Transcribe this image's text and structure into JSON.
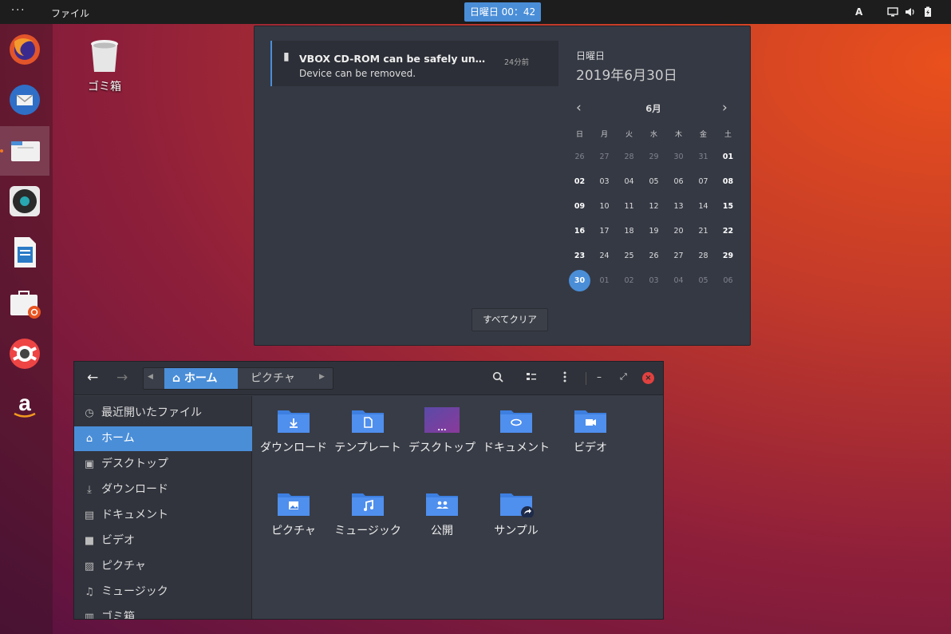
{
  "topbar": {
    "activities": "···",
    "app_menu": "ファイル",
    "clock": "日曜日 00：42",
    "keyboard": "A"
  },
  "dock": {
    "items": [
      {
        "name": "firefox"
      },
      {
        "name": "thunderbird"
      },
      {
        "name": "files"
      },
      {
        "name": "rhythmbox"
      },
      {
        "name": "libreoffice-writer"
      },
      {
        "name": "ubuntu-software"
      },
      {
        "name": "help"
      },
      {
        "name": "amazon"
      }
    ]
  },
  "desktop": {
    "trash_label": "ゴミ箱"
  },
  "notification": {
    "title": "VBOX CD-ROM can be safely unplugged",
    "time": "24分前",
    "body": "Device can be removed."
  },
  "calendar": {
    "day_name": "日曜日",
    "full_date": "2019年6月30日",
    "month": "6月",
    "weekdays": [
      "日",
      "月",
      "火",
      "水",
      "木",
      "金",
      "土"
    ],
    "weeks": [
      [
        "26",
        "27",
        "28",
        "29",
        "30",
        "31",
        "01"
      ],
      [
        "02",
        "03",
        "04",
        "05",
        "06",
        "07",
        "08"
      ],
      [
        "09",
        "10",
        "11",
        "12",
        "13",
        "14",
        "15"
      ],
      [
        "16",
        "17",
        "18",
        "19",
        "20",
        "21",
        "22"
      ],
      [
        "23",
        "24",
        "25",
        "26",
        "27",
        "28",
        "29"
      ],
      [
        "30",
        "01",
        "02",
        "03",
        "04",
        "05",
        "06"
      ]
    ],
    "today": "30",
    "clear_all": "すべてクリア"
  },
  "files": {
    "path": {
      "home": "ホーム",
      "next": "ピクチャ"
    },
    "sidebar": [
      {
        "label": "最近開いたファイル",
        "icon": "clock-icon"
      },
      {
        "label": "ホーム",
        "icon": "home-icon"
      },
      {
        "label": "デスクトップ",
        "icon": "desktop-icon"
      },
      {
        "label": "ダウンロード",
        "icon": "download-icon"
      },
      {
        "label": "ドキュメント",
        "icon": "document-icon"
      },
      {
        "label": "ビデオ",
        "icon": "video-icon"
      },
      {
        "label": "ピクチャ",
        "icon": "picture-icon"
      },
      {
        "label": "ミュージック",
        "icon": "music-icon"
      },
      {
        "label": "ゴミ箱",
        "icon": "trash-icon"
      }
    ],
    "items": [
      {
        "label": "ダウンロード",
        "icon": "download"
      },
      {
        "label": "テンプレート",
        "icon": "template"
      },
      {
        "label": "デスクトップ",
        "icon": "desktop"
      },
      {
        "label": "ドキュメント",
        "icon": "document"
      },
      {
        "label": "ビデオ",
        "icon": "video"
      },
      {
        "label": "ピクチャ",
        "icon": "picture"
      },
      {
        "label": "ミュージック",
        "icon": "music"
      },
      {
        "label": "公開",
        "icon": "public"
      },
      {
        "label": "サンプル",
        "icon": "examples"
      }
    ]
  },
  "colors": {
    "accent": "#4a8ed8",
    "folder": "#3d7fe0",
    "close": "#e0413f",
    "panel": "#353944"
  }
}
